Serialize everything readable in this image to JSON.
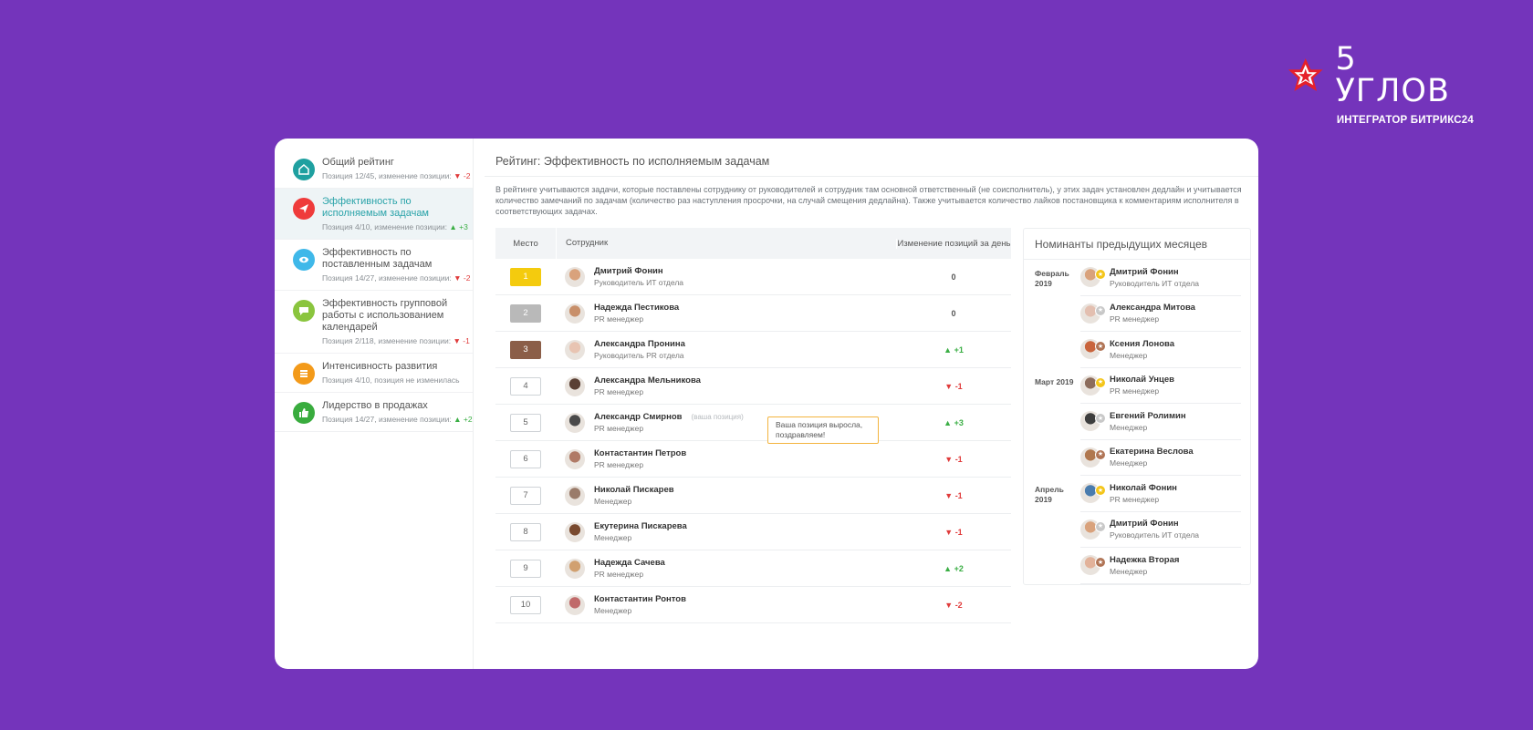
{
  "brand": {
    "name": "5 УГЛОВ",
    "subtitle": "ИНТЕГРАТОР БИТРИКС24",
    "colors": {
      "logo": "#e5202a",
      "background": "#7434bb"
    }
  },
  "sidebar": {
    "items": [
      {
        "title": "Общий рейтинг",
        "sub": "Позиция 12/45, изменение позиции:",
        "delta": "▼ -2",
        "dir": "down",
        "icon": "home-icon",
        "color": "#1fa0a0",
        "active": false
      },
      {
        "title": "Эффективность по исполняемым задачам",
        "sub": "Позиция 4/10, изменение позиции:",
        "delta": "▲ +3",
        "dir": "up",
        "icon": "send-icon",
        "color": "#ef3b3b",
        "active": true
      },
      {
        "title": "Эффективность по поставленным задачам",
        "sub": "Позиция 14/27, изменение позиции:",
        "delta": "▼ -2",
        "dir": "down",
        "icon": "eye-icon",
        "color": "#3fb8e9",
        "active": false
      },
      {
        "title": "Эффективность групповой работы с использованием календарей",
        "sub": "Позиция 2/118, изменение позиции:",
        "delta": "▼ -1",
        "dir": "down",
        "icon": "chat-icon",
        "color": "#8ac53e",
        "active": false
      },
      {
        "title": "Интенсивность развития",
        "sub": "Позиция 4/10, позиция не изменилась",
        "delta": "",
        "dir": "none",
        "icon": "list-icon",
        "color": "#f39a1a",
        "active": false
      },
      {
        "title": "Лидерство в продажах",
        "sub": "Позиция 14/27, изменение позиции:",
        "delta": "▲ +2",
        "dir": "up",
        "icon": "thumb-icon",
        "color": "#39ac3e",
        "active": false
      }
    ]
  },
  "main": {
    "title": "Рейтинг: Эффективность по исполняемым задачам",
    "description": "В рейтинге учитываются задачи, которые поставлены сотруднику от руководителей и сотрудник там основной ответственный (не соисполнитель), у этих задач установлен дедлайн и учитывается количество  замечаний по задачам (количество раз наступления просрочки, на случай смещения дедлайна). Также учитывается количество лайков постановщика к комментариям исполнителя в соответствующих задачах."
  },
  "rating": {
    "headers": {
      "place": "Место",
      "employee": "Сотрудник",
      "change": "Изменение позиций за день"
    },
    "your_position": "(ваша позиция)",
    "tooltip": "Ваша позиция выросла, поздравляем!",
    "rows": [
      {
        "place": "1",
        "name": "Дмитрий Фонин",
        "role": "Руководитель ИТ отдела",
        "change": "0",
        "dir": "none",
        "medal": "gold",
        "avatar": "#d9a27c"
      },
      {
        "place": "2",
        "name": "Надежда Пестикова",
        "role": "PR менеджер",
        "change": "0",
        "dir": "none",
        "medal": "silver",
        "avatar": "#c88f6a"
      },
      {
        "place": "3",
        "name": "Александра Пронина",
        "role": "Руководитель PR отдела",
        "change": "▲ +1",
        "dir": "up",
        "medal": "bronze",
        "avatar": "#e8c4b2"
      },
      {
        "place": "4",
        "name": "Александра Мельникова",
        "role": "PR менеджер",
        "change": "▼ -1",
        "dir": "down",
        "medal": "",
        "avatar": "#5a4035"
      },
      {
        "place": "5",
        "name": "Александр Смирнов",
        "role": "PR менеджер",
        "change": "▲ +3",
        "dir": "up",
        "medal": "",
        "avatar": "#4a4a4a",
        "you": true
      },
      {
        "place": "6",
        "name": "Контастантин Петров",
        "role": "PR менеджер",
        "change": "▼ -1",
        "dir": "down",
        "medal": "",
        "avatar": "#b07a66"
      },
      {
        "place": "7",
        "name": "Николай Пискарев",
        "role": "Менеджер",
        "change": "▼ -1",
        "dir": "down",
        "medal": "",
        "avatar": "#9a7b6a"
      },
      {
        "place": "8",
        "name": "Екутерина Пискарева",
        "role": "Менеджер",
        "change": "▼ -1",
        "dir": "down",
        "medal": "",
        "avatar": "#7a4a2f"
      },
      {
        "place": "9",
        "name": "Надежда Сачева",
        "role": "PR менеджер",
        "change": "▲ +2",
        "dir": "up",
        "medal": "",
        "avatar": "#d1a070"
      },
      {
        "place": "10",
        "name": "Контастантин Ронтов",
        "role": "Менеджер",
        "change": "▼ -2",
        "dir": "down",
        "medal": "",
        "avatar": "#c06a6a"
      }
    ]
  },
  "nominees": {
    "title": "Номинанты предыдущих месяцев",
    "rows": [
      {
        "month": "Февраль 2019",
        "name": "Дмитрий Фонин",
        "role": "Руководитель ИТ отдела",
        "medal": "gold",
        "avatar": "#d9a27c"
      },
      {
        "month": "",
        "name": "Александра Митова",
        "role": "PR менеджер",
        "medal": "silver",
        "avatar": "#e3bfb0"
      },
      {
        "month": "",
        "name": "Ксения Лонова",
        "role": "Менеджер",
        "medal": "bronze",
        "avatar": "#c9643c"
      },
      {
        "month": "Март 2019",
        "name": "Николай Унцев",
        "role": "PR менеджер",
        "medal": "gold",
        "avatar": "#8c6c5c"
      },
      {
        "month": "",
        "name": "Евгений Ролимин",
        "role": "Менеджер",
        "medal": "silver",
        "avatar": "#3e3e3e"
      },
      {
        "month": "",
        "name": "Екатерина Веслова",
        "role": "Менеджер",
        "medal": "bronze",
        "avatar": "#b0774e"
      },
      {
        "month": "Апрель 2019",
        "name": "Николай Фонин",
        "role": "PR менеджер",
        "medal": "gold",
        "avatar": "#4a7cae"
      },
      {
        "month": "",
        "name": "Дмитрий Фонин",
        "role": "Руководитель ИТ отдела",
        "medal": "silver",
        "avatar": "#d9a27c"
      },
      {
        "month": "",
        "name": "Надежка Вторая",
        "role": "Менеджер",
        "medal": "bronze",
        "avatar": "#e2b29a"
      }
    ]
  }
}
